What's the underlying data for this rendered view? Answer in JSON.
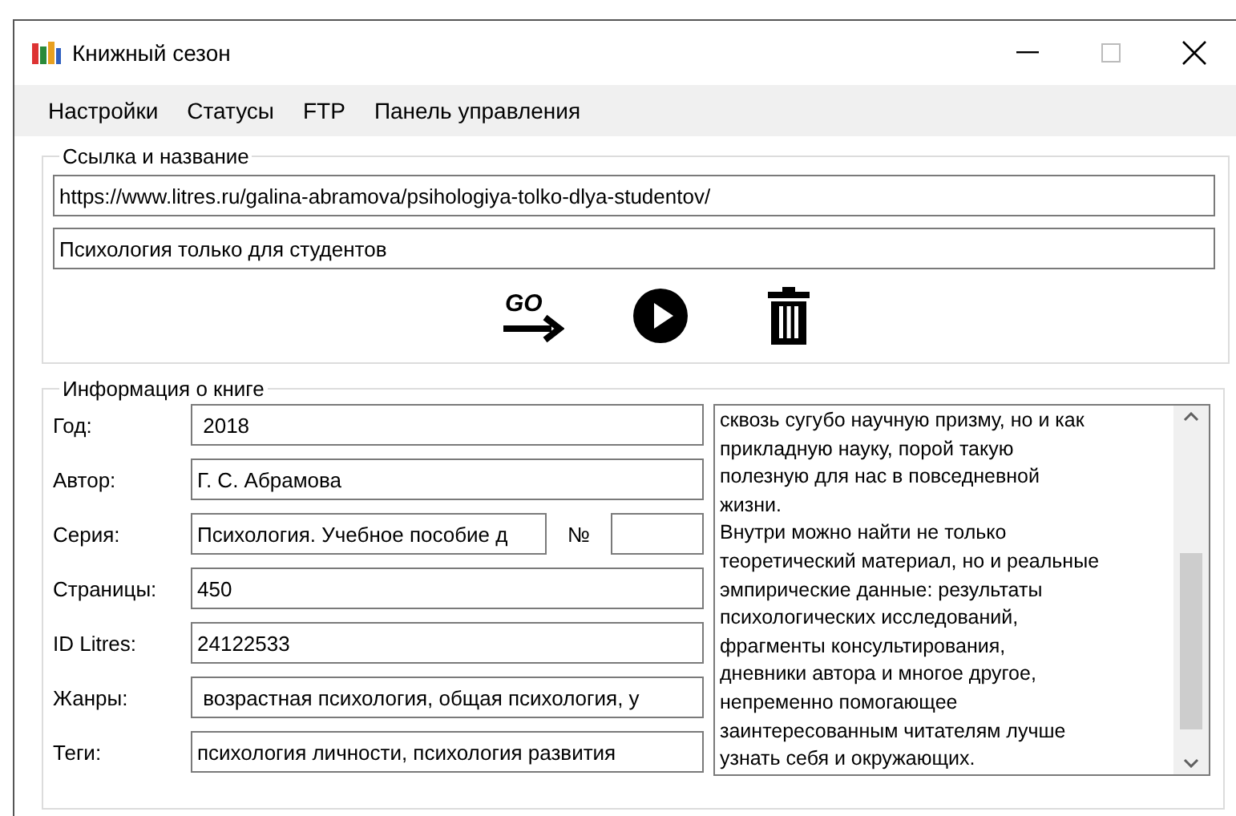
{
  "window": {
    "title": "Книжный сезон"
  },
  "menu": [
    "Настройки",
    "Статусы",
    "FTP",
    "Панель управления"
  ],
  "link_group": {
    "title": "Ссылка и название",
    "url": "https://www.litres.ru/galina-abramova/psihologiya-tolko-dlya-studentov/",
    "name": "Психология только для студентов",
    "go_label": "GO"
  },
  "info_group": {
    "title": "Информация о книге",
    "fields": [
      {
        "label": "Год:",
        "value": " 2018"
      },
      {
        "label": "Автор:",
        "value": "Г. С. Абрамова"
      },
      {
        "label": "Серия:",
        "value": "Психология. Учебное пособие д",
        "number_label": "№"
      },
      {
        "label": "Страницы:",
        "value": "450"
      },
      {
        "label": "ID Litres:",
        "value": "24122533"
      },
      {
        "label": "Жанры:",
        "value": " возрастная психология, общая психология, у"
      },
      {
        "label": "Теги:",
        "value": "психология личности, психология развития"
      }
    ],
    "description": "сквозь сугубо научную призму, но и как\nприкладную науку, порой такую\nполезную для нас в повседневной\nжизни.\nВнутри можно найти не только\nтеоретический материал, но и реальные\nэмпирические данные: результаты\nпсихологических исследований,\nфрагменты консультирования,\nдневники автора и многое другое,\nнепременно помогающее\nзаинтересованным читателям лучше\nузнать себя и окружающих."
  }
}
